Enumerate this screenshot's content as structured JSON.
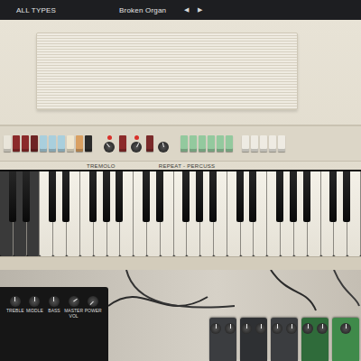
{
  "top_bar": {
    "category": "ALL TYPES",
    "preset": "Broken Organ",
    "prev": "◀",
    "next": "▶"
  },
  "panel": {
    "groups": [
      {
        "controls": [
          {
            "kind": "switch",
            "color": "#e9e5da"
          },
          {
            "kind": "switch",
            "color": "#8b2a2a"
          },
          {
            "kind": "switch",
            "color": "#8b2a2a"
          },
          {
            "kind": "switch",
            "color": "#6e2424"
          },
          {
            "kind": "switch",
            "color": "#a9cfdd"
          },
          {
            "kind": "switch",
            "color": "#a9cfdd"
          },
          {
            "kind": "switch",
            "color": "#a9cfdd"
          },
          {
            "kind": "switch",
            "color": "#efe6cf"
          },
          {
            "kind": "switch",
            "color": "#d9a062"
          },
          {
            "kind": "switch",
            "color": "#2a2a2a"
          }
        ]
      },
      {
        "controls": [
          {
            "kind": "knob",
            "lamp": true,
            "level": 0.35
          },
          {
            "kind": "switch",
            "color": "#8b2a2a"
          },
          {
            "kind": "knob",
            "lamp": true,
            "level": 0.6
          },
          {
            "kind": "switch",
            "color": "#7a2a2a"
          },
          {
            "kind": "knob",
            "lamp": false,
            "level": 0.45
          }
        ]
      },
      {
        "controls": [
          {
            "kind": "switch",
            "color": "#93c99e"
          },
          {
            "kind": "switch",
            "color": "#93c99e"
          },
          {
            "kind": "switch",
            "color": "#93c99e"
          },
          {
            "kind": "switch",
            "color": "#93c99e"
          },
          {
            "kind": "switch",
            "color": "#93c99e"
          },
          {
            "kind": "switch",
            "color": "#93c99e"
          }
        ]
      },
      {
        "controls": [
          {
            "kind": "switch",
            "color": "#eeebe3"
          },
          {
            "kind": "switch",
            "color": "#eeebe3"
          },
          {
            "kind": "switch",
            "color": "#eeebe3"
          },
          {
            "kind": "switch",
            "color": "#eeebe3"
          },
          {
            "kind": "switch",
            "color": "#eeebe3"
          }
        ]
      }
    ],
    "labels": [
      "TREMOLO",
      "REPEAT - PERCUSS"
    ]
  },
  "keyboard": {
    "sections": [
      {
        "kind": "bass",
        "white_keys": 3
      },
      {
        "kind": "treble",
        "white_keys": 24
      }
    ]
  },
  "amp": {
    "knobs": [
      {
        "label": "TREBLE",
        "level": 0.5
      },
      {
        "label": "MIDDLE",
        "level": 0.5
      },
      {
        "label": "BASS",
        "level": 0.5
      },
      {
        "label": "MASTER VOL",
        "level": 0.7
      },
      {
        "label": "POWER",
        "level": 0.0
      }
    ]
  },
  "pedals": [
    {
      "color": "#3b3d40",
      "knobs": 2
    },
    {
      "color": "#2e3033",
      "knobs": 2
    },
    {
      "color": "#3b3d40",
      "knobs": 2
    },
    {
      "color": "#2f6b3a",
      "knobs": 2
    },
    {
      "color": "#3f8a4a",
      "knobs": 1
    }
  ]
}
